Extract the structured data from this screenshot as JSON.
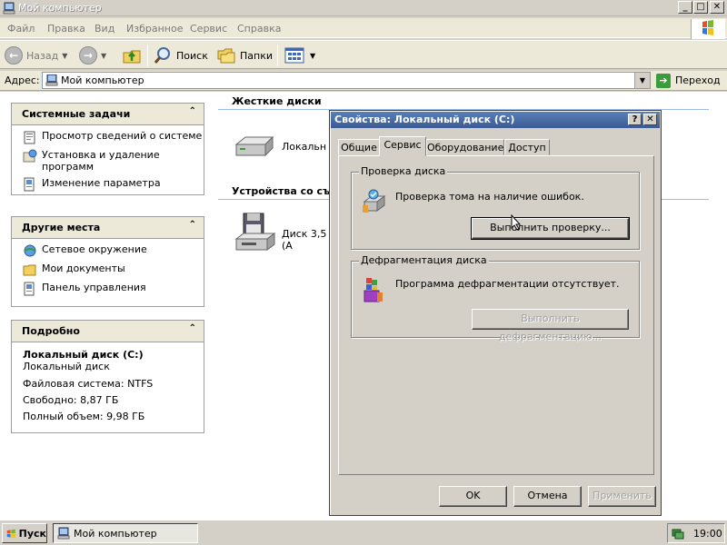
{
  "window": {
    "title": "Мой компьютер"
  },
  "menu": {
    "items": [
      "Файл",
      "Правка",
      "Вид",
      "Избранное",
      "Сервис",
      "Справка"
    ]
  },
  "toolbar": {
    "back_label": "Назад",
    "search_label": "Поиск",
    "folders_label": "Папки"
  },
  "address": {
    "label": "Адрес:",
    "value": "Мой компьютер",
    "go_label": "Переход"
  },
  "sidebar": {
    "system_tasks": {
      "title": "Системные задачи",
      "items": [
        {
          "label": "Просмотр сведений о системе",
          "icon": "system-info-icon"
        },
        {
          "label": "Установка и удаление программ",
          "icon": "add-remove-icon"
        },
        {
          "label": "Изменение параметра",
          "icon": "control-panel-icon"
        }
      ]
    },
    "other_places": {
      "title": "Другие места",
      "items": [
        {
          "label": "Сетевое окружение",
          "icon": "network-icon"
        },
        {
          "label": "Мои документы",
          "icon": "folder-icon"
        },
        {
          "label": "Панель управления",
          "icon": "control-panel-icon"
        }
      ]
    },
    "details": {
      "title": "Подробно",
      "name": "Локальный диск (C:)",
      "type": "Локальный диск",
      "fs": "Файловая система: NTFS",
      "free": "Свободно: 8,87 ГБ",
      "total": "Полный объем: 9,98 ГБ"
    }
  },
  "main": {
    "hard_disks_title": "Жесткие диски",
    "local_disk_label": "Локальн",
    "removable_title": "Устройства со съе",
    "floppy_label": "Диск 3,5 (А"
  },
  "dialog": {
    "title": "Свойства: Локальный диск (C:)",
    "help_btn": "?",
    "close_btn": "✕",
    "tabs": [
      "Общие",
      "Сервис",
      "Оборудование",
      "Доступ"
    ],
    "active_tab": "Сервис",
    "check": {
      "legend": "Проверка диска",
      "text": "Проверка тома на наличие ошибок.",
      "button": "Выполнить проверку..."
    },
    "defrag": {
      "legend": "Дефрагментация диска",
      "text": "Программа дефрагментации отсутствует.",
      "button": "Выполнить дефрагментацию..."
    },
    "ok": "OK",
    "cancel": "Отмена",
    "apply": "Применить"
  },
  "taskbar": {
    "start_label": "Пуск",
    "active_window": "Мой компьютер",
    "clock": "19:00"
  }
}
